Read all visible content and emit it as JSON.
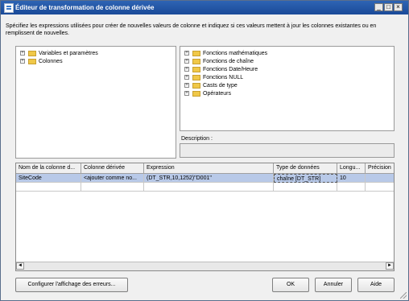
{
  "window": {
    "title": "Éditeur de transformation de colonne dérivée"
  },
  "window_controls": {
    "minimize": "_",
    "maximize": "□",
    "close": "×"
  },
  "instructions": "Spécifiez les expressions utilisées pour créer de nouvelles valeurs de colonne et indiquez si ces valeurs mettent à jour les colonnes existantes ou en remplissent de nouvelles.",
  "left_tree": {
    "items": [
      {
        "label": "Variables et paramètres",
        "expander": "+"
      },
      {
        "label": "Colonnes",
        "expander": "+"
      }
    ]
  },
  "right_tree": {
    "items": [
      {
        "label": "Fonctions mathématiques",
        "expander": "+"
      },
      {
        "label": "Fonctions de chaîne",
        "expander": "+"
      },
      {
        "label": "Fonctions Date/Heure",
        "expander": "+"
      },
      {
        "label": "Fonctions NULL",
        "expander": "+"
      },
      {
        "label": "Casts de type",
        "expander": "+"
      },
      {
        "label": "Opérateurs",
        "expander": "+"
      }
    ]
  },
  "description": {
    "label": "Description :"
  },
  "grid": {
    "columns": [
      "Nom de la colonne d...",
      "Colonne dérivée",
      "Expression",
      "Type de données",
      "Longu...",
      "Précision"
    ],
    "rows": [
      [
        "SiteCode",
        "<ajouter comme no...",
        "(DT_STR,10,1252)\"D001\"",
        "chaîne [DT_STR]",
        "10",
        ""
      ]
    ]
  },
  "scroll": {
    "left_arrow": "◄",
    "right_arrow": "►"
  },
  "buttons": {
    "configure_errors": "Configurer l'affichage des erreurs...",
    "ok": "OK",
    "cancel": "Annuler",
    "help": "Aide"
  }
}
